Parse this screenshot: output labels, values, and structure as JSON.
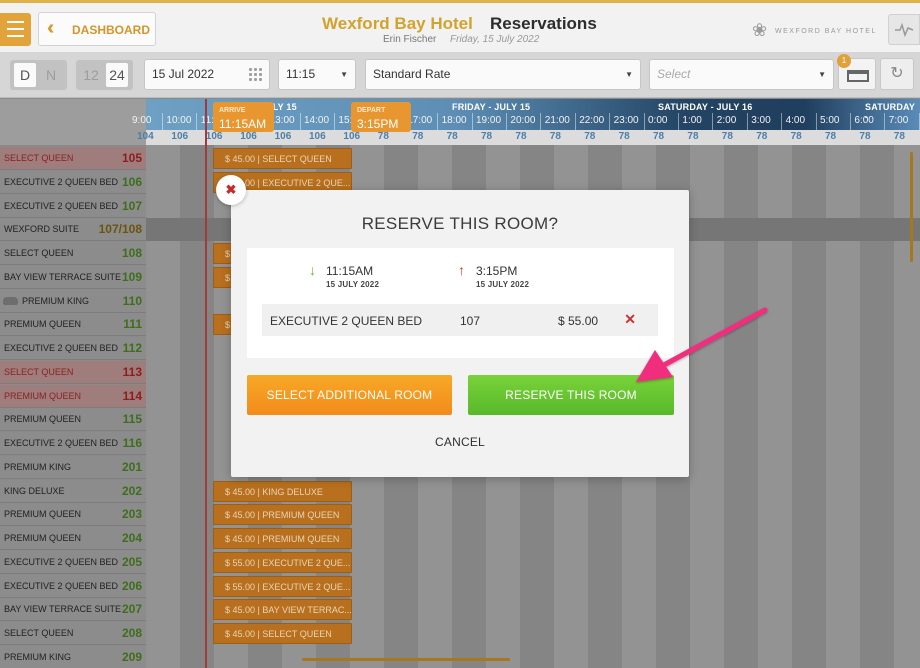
{
  "header": {
    "dashboard_label": "DASHBOARD",
    "hotel_name": "Wexford Bay Hotel",
    "page_title": "Reservations",
    "user": "Erin Fischer",
    "date": "Friday, 15 July 2022",
    "logo_text": "WEXFORD BAY HOTEL"
  },
  "toolbar": {
    "view_day": "D",
    "view_night": "N",
    "clock_12": "12",
    "clock_24": "24",
    "date_value": "15 Jul 2022",
    "time_value": "11:15",
    "rate_value": "Standard Rate",
    "select_placeholder": "Select",
    "cart_count": "1"
  },
  "timeline": {
    "day_headers": [
      {
        "label": "- JULY 15"
      },
      {
        "label": "FRIDAY - JULY 15"
      },
      {
        "label": "SATURDAY - JULY 16"
      },
      {
        "label": "SATURDAY -"
      }
    ],
    "hours": [
      "9:00",
      "10:00",
      "11:00",
      "12:00",
      "13:00",
      "14:00",
      "15:00",
      "16:00",
      "17:00",
      "18:00",
      "19:00",
      "20:00",
      "21:00",
      "22:00",
      "23:00",
      "0:00",
      "1:00",
      "2:00",
      "3:00",
      "4:00",
      "5:00",
      "6:00",
      "7:00"
    ],
    "rates": [
      "104",
      "106",
      "106",
      "106",
      "106",
      "106",
      "106",
      "78",
      "78",
      "78",
      "78",
      "78",
      "78",
      "78",
      "78",
      "78",
      "78",
      "78",
      "78",
      "78",
      "78",
      "78",
      "78"
    ],
    "arrive_label": "ARRIVE",
    "arrive_time": "11:15AM",
    "depart_label": "DEPART",
    "depart_time": "3:15PM"
  },
  "rooms": [
    {
      "name": "SELECT QUEEN",
      "number": "105",
      "status": "warn",
      "booking": "$ 45.00 | SELECT QUEEN"
    },
    {
      "name": "EXECUTIVE 2 QUEEN BED",
      "number": "106",
      "status": "ok",
      "booking": "$ 55.00 | EXECUTIVE 2 QUE..."
    },
    {
      "name": "EXECUTIVE 2 QUEEN BED",
      "number": "107",
      "status": "ok",
      "booking": ""
    },
    {
      "name": "WEXFORD SUITE",
      "number": "107/108",
      "status": "mid",
      "booking": ""
    },
    {
      "name": "SELECT QUEEN",
      "number": "108",
      "status": "ok",
      "booking": "$"
    },
    {
      "name": "BAY VIEW TERRACE SUITE",
      "number": "109",
      "status": "ok",
      "booking": "$"
    },
    {
      "name": "PREMIUM KING",
      "number": "110",
      "status": "ok",
      "booking": ""
    },
    {
      "name": "PREMIUM QUEEN",
      "number": "111",
      "status": "ok",
      "booking": "$"
    },
    {
      "name": "EXECUTIVE 2 QUEEN BED",
      "number": "112",
      "status": "ok",
      "booking": ""
    },
    {
      "name": "SELECT QUEEN",
      "number": "113",
      "status": "warn",
      "booking": ""
    },
    {
      "name": "PREMIUM QUEEN",
      "number": "114",
      "status": "warn",
      "booking": ""
    },
    {
      "name": "PREMIUM QUEEN",
      "number": "115",
      "status": "ok",
      "booking": ""
    },
    {
      "name": "EXECUTIVE 2 QUEEN BED",
      "number": "116",
      "status": "ok",
      "booking": ""
    },
    {
      "name": "PREMIUM KING",
      "number": "201",
      "status": "ok",
      "booking": ""
    },
    {
      "name": "KING DELUXE",
      "number": "202",
      "status": "ok",
      "booking": "$ 45.00 | KING DELUXE"
    },
    {
      "name": "PREMIUM QUEEN",
      "number": "203",
      "status": "ok",
      "booking": "$ 45.00 | PREMIUM QUEEN"
    },
    {
      "name": "PREMIUM QUEEN",
      "number": "204",
      "status": "ok",
      "booking": "$ 45.00 | PREMIUM QUEEN"
    },
    {
      "name": "EXECUTIVE 2 QUEEN BED",
      "number": "205",
      "status": "ok",
      "booking": "$ 55.00 | EXECUTIVE 2 QUE..."
    },
    {
      "name": "EXECUTIVE 2 QUEEN BED",
      "number": "206",
      "status": "ok",
      "booking": "$ 55.00 | EXECUTIVE 2 QUE..."
    },
    {
      "name": "BAY VIEW TERRACE SUITE",
      "number": "207",
      "status": "ok",
      "booking": "$ 45.00 | BAY VIEW TERRAC..."
    },
    {
      "name": "SELECT QUEEN",
      "number": "208",
      "status": "ok",
      "booking": "$ 45.00 | SELECT QUEEN"
    },
    {
      "name": "PREMIUM KING",
      "number": "209",
      "status": "ok",
      "booking": ""
    }
  ],
  "modal": {
    "title": "RESERVE THIS ROOM?",
    "arrive_time": "11:15AM",
    "arrive_date": "15 JULY 2022",
    "depart_time": "3:15PM",
    "depart_date": "15 JULY 2022",
    "line": {
      "room_type": "EXECUTIVE 2 QUEEN BED",
      "room_number": "107",
      "price": "$ 55.00"
    },
    "select_additional_label": "SELECT ADDITIONAL ROOM",
    "reserve_label": "RESERVE THIS ROOM",
    "cancel_label": "CANCEL"
  },
  "colors": {
    "accent_orange": "#f28b1c",
    "reserve_green": "#58b92a",
    "brand_gold": "#d2a32c",
    "pointer_pink": "#f02e7d"
  }
}
